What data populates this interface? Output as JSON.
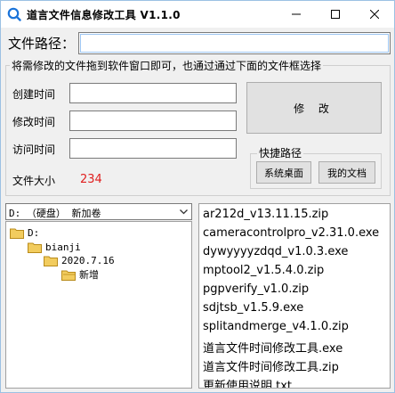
{
  "window": {
    "title": "道言文件信息修改工具 V1.1.0",
    "icon": "search-icon"
  },
  "path": {
    "label": "文件路径：",
    "value": ""
  },
  "main_group": {
    "caption": "将需修改的文件拖到软件窗口即可，也通过通过下面的文件框选择",
    "fields": [
      {
        "label": "创建时间",
        "value": ""
      },
      {
        "label": "修改时间",
        "value": ""
      },
      {
        "label": "访问时间",
        "value": ""
      }
    ],
    "size_label": "文件大小",
    "size_value": "234",
    "modify_button": "修 改"
  },
  "quick_paths": {
    "caption": "快捷路径",
    "desktop_button": "系统桌面",
    "docs_button": "我的文档"
  },
  "drive": {
    "selected": "D: （硬盘） 新加卷"
  },
  "dir_tree": [
    {
      "label": "D:"
    },
    {
      "label": "bianji"
    },
    {
      "label": "2020.7.16"
    },
    {
      "label": "新增"
    }
  ],
  "files": [
    "ar212d_v13.11.15.zip",
    "cameracontrolpro_v2.31.0.exe",
    "dywyyyyzdqd_v1.0.3.exe",
    "mptool2_v1.5.4.0.zip",
    "pgpverify_v1.0.zip",
    "sdjtsb_v1.5.9.exe",
    "splitandmerge_v4.1.0.zip",
    "道言文件时间修改工具.exe",
    "道言文件时间修改工具.zip",
    "更新使用说明.txt"
  ],
  "colors": {
    "accent": "#3c8ee6",
    "size_value": "#e02020",
    "folder": "#f2cc5e"
  }
}
